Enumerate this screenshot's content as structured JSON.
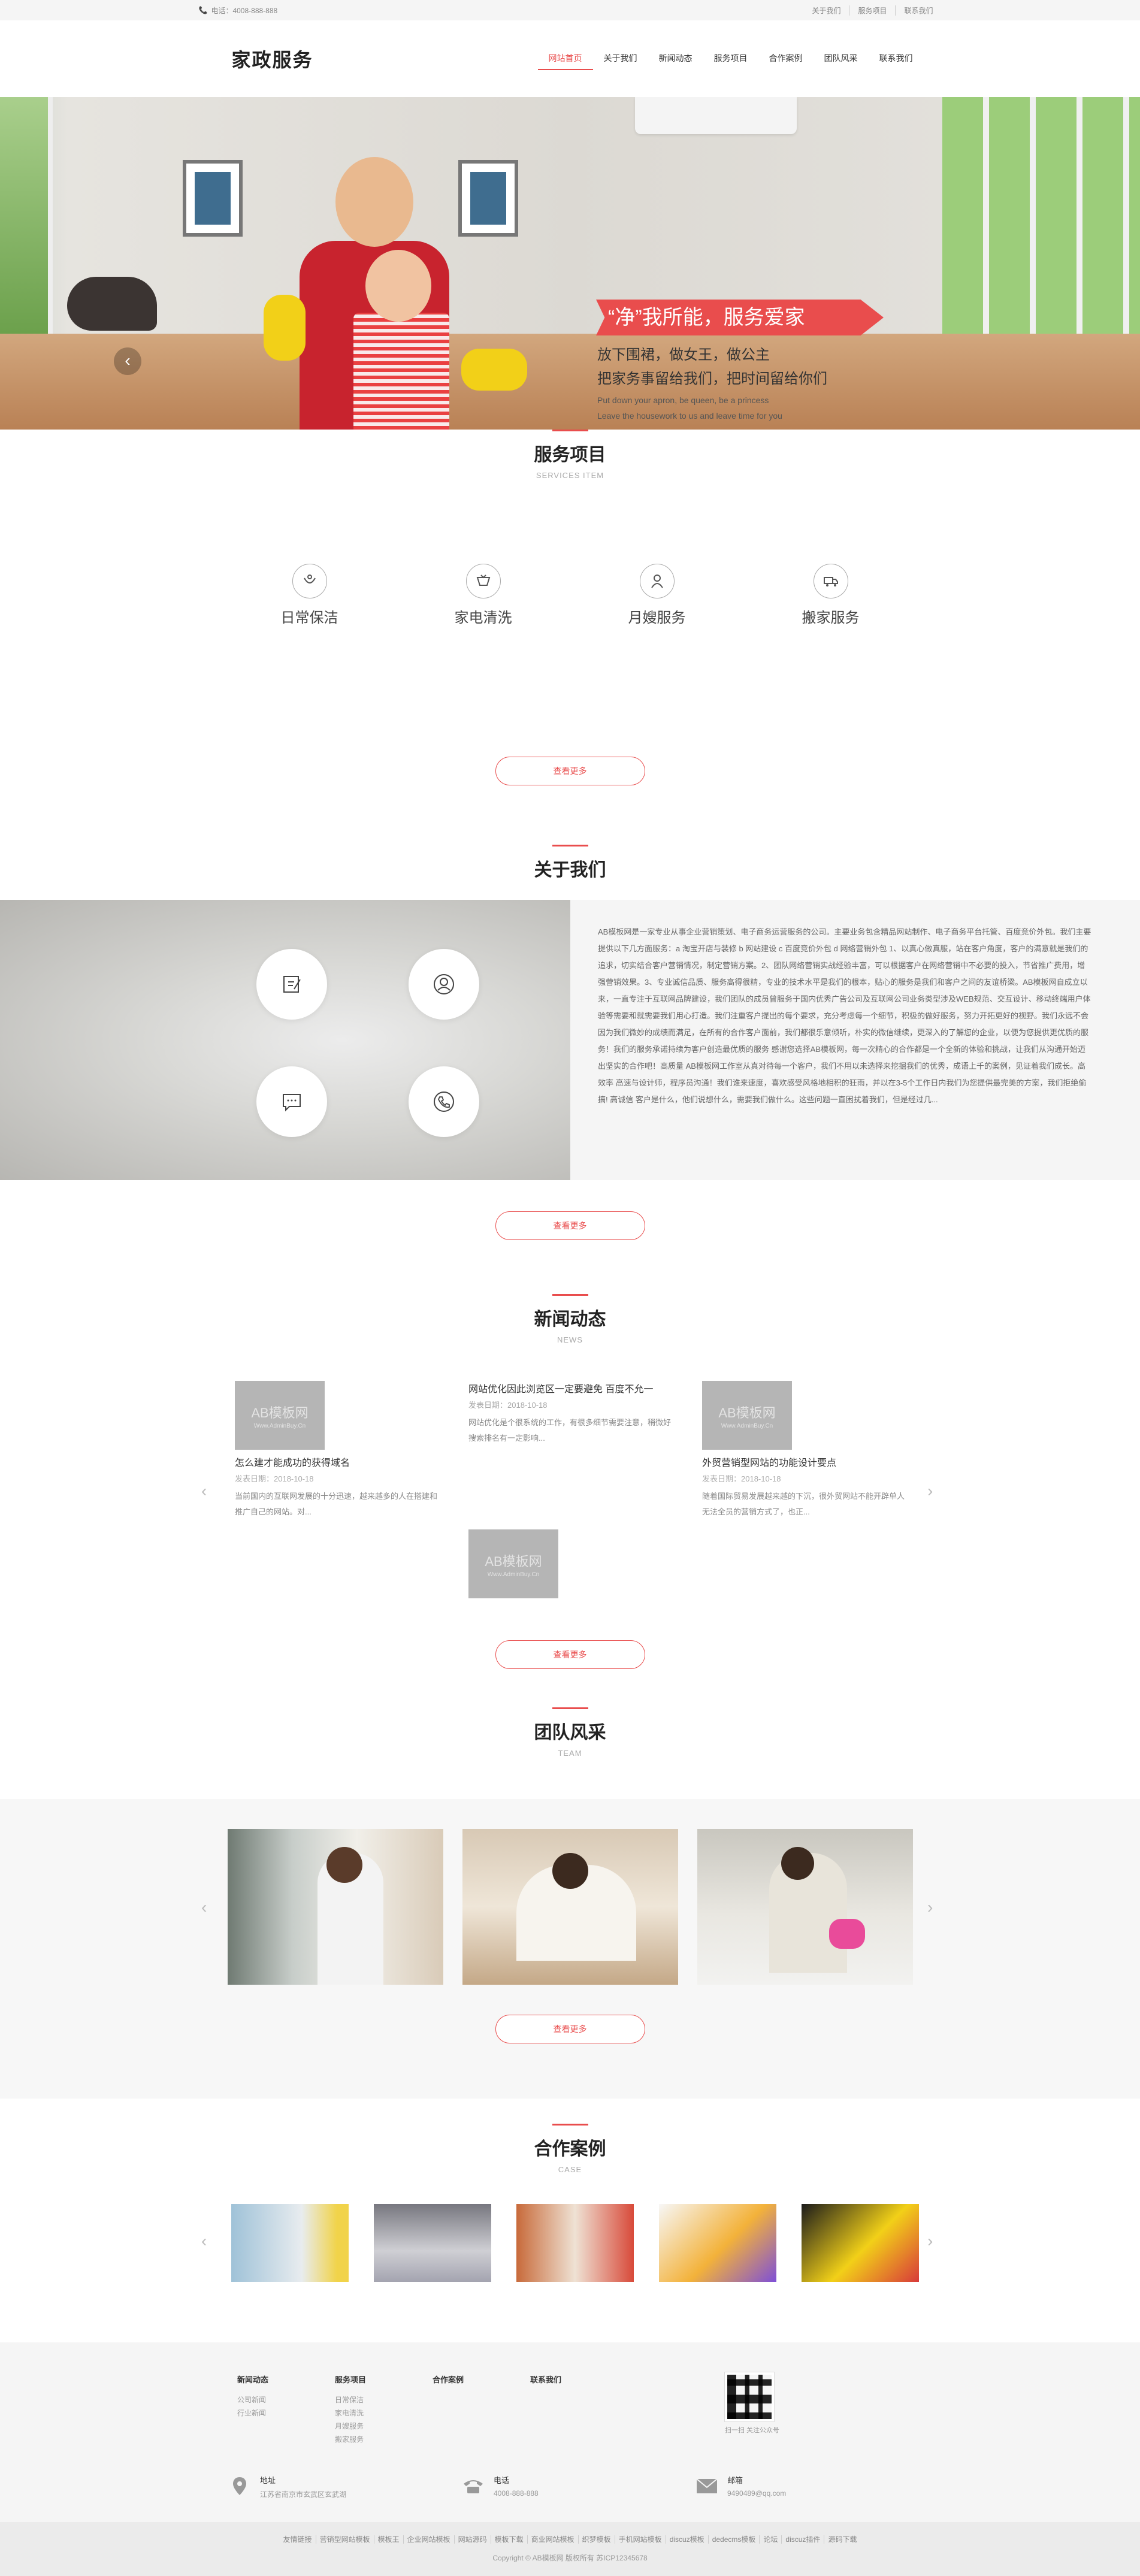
{
  "topbar": {
    "phone": "电话：4008-888-888",
    "links": [
      "关于我们",
      "服务项目",
      "联系我们"
    ]
  },
  "header": {
    "logo": "家政服务",
    "nav": [
      "网站首页",
      "关于我们",
      "新闻动态",
      "服务项目",
      "合作案例",
      "团队风采",
      "联系我们"
    ],
    "active_index": 0
  },
  "banner": {
    "tag": "“净”我所能，服务爱家",
    "line1": "放下围裙，做女王，做公主",
    "line2": "把家务事留给我们，把时间留给你们",
    "en1": "Put down your apron, be queen, be a princess",
    "en2": "Leave the housework to us and leave time for you"
  },
  "services": {
    "title": "服务项目",
    "en": "SERVICES ITEM",
    "items": [
      {
        "label": "日常保洁",
        "icon": "cleaning-icon"
      },
      {
        "label": "家电清洗",
        "icon": "appliance-icon"
      },
      {
        "label": "月嫂服务",
        "icon": "nanny-icon"
      },
      {
        "label": "搬家服务",
        "icon": "moving-truck-icon"
      }
    ],
    "more": "查看更多"
  },
  "about": {
    "title": "关于我们",
    "text": "AB模板网是一家专业从事企业营销策划、电子商务运营服务的公司。主要业务包含精品网站制作、电子商务平台托管、百度竞价外包。我们主要提供以下几方面服务：a 淘宝开店与装修 b 网站建设 c 百度竞价外包 d 网络营销外包 1、以真心做真服，站在客户角度，客户的满意就是我们的追求，切实结合客户营销情况，制定营销方案。2、团队网络营销实战经验丰富，可以根据客户在网络营销中不必要的投入，节省推广费用，增强营销效果。3、专业诚信品质、服务高得很精，专业的技术水平是我们的根本，贴心的服务是我们和客户之间的友谊桥梁。AB模板网自成立以来，一直专注于互联网品牌建设，我们团队的成员曾服务于国内优秀广告公司及互联网公司业务类型涉及WEB规范、交互设计、移动终端用户体验等需要和就需要我们用心打造。我们注重客户提出的每个要求，充分考虑每一个细节，积极的做好服务，努力开拓更好的视野。我们永远不会因为我们微妙的成绩而满足，在所有的合作客户面前，我们都很乐意倾听，朴实的微信继续，更深入的了解您的企业，以便为您提供更优质的服务！我们的服务承诺持续为客户创造最优质的服务 感谢您选择AB模板网，每一次精心的合作都是一个全新的体验和挑战，让我们从沟通开始迈出坚实的合作吧！高质量 AB模板网工作室从真对待每一个客户，我们不用以未选择来挖掘我们的优秀，成语上千的案例，见证着我们成长。高效率 高速与设计师，程序员沟通！我们谁来速度，喜欢感受风格地相积的狂雨，并以在3-5个工作日内我们为您提供最完美的方案，我们拒绝偷搞! 高诚信 客户是什么，他们说想什么，需要我们做什么。这些问题一直困扰着我们，但是经过几..."
  },
  "news": {
    "title": "新闻动态",
    "en": "NEWS",
    "thumb_text": "AB模板网",
    "thumb_url": "Www.AdminBuy.Cn",
    "items": [
      {
        "title": "怎么建才能成功的获得域名",
        "date": "发表日期：2018-10-18",
        "desc": "当前国内的互联网发展的十分迅速，越来越多的人在搭建和推广自己的网站。对..."
      },
      {
        "title": "网站优化因此浏览区一定要避免 百度不允一",
        "date": "发表日期：2018-10-18",
        "desc": "网站优化是个很系统的工作，有很多细节需要注意，稍微好搜索排名有一定影响..."
      },
      {
        "title": "外贸营销型网站的功能设计要点",
        "date": "发表日期：2018-10-18",
        "desc": "随着国际贸易发展越来越的下沉，很外贸网站不能开辟单人无法全员的营销方式了，也正..."
      }
    ]
  },
  "team": {
    "title": "团队风采",
    "en": "TEAM"
  },
  "cases": {
    "title": "合作案例",
    "en": "CASE"
  },
  "footer": {
    "cols": [
      {
        "title": "新闻动态",
        "items": [
          "公司新闻",
          "行业新闻"
        ]
      },
      {
        "title": "服务项目",
        "items": [
          "日常保洁",
          "家电清洗",
          "月嫂服务",
          "搬家服务"
        ]
      },
      {
        "title": "合作案例",
        "items": []
      },
      {
        "title": "联系我们",
        "items": []
      }
    ],
    "qr_caption": "扫一扫 关注公众号",
    "contacts": [
      {
        "label": "地址",
        "value": "江苏省南京市玄武区玄武湖",
        "icon": "location-icon"
      },
      {
        "label": "电话",
        "value": "4008-888-888",
        "icon": "phone-icon"
      },
      {
        "label": "邮箱",
        "value": "9490489@qq.com",
        "icon": "mail-icon"
      }
    ]
  },
  "copyright": {
    "links": [
      "友情链接",
      "营销型网站模板",
      "模板王",
      "企业网站模板",
      "网站源码",
      "模板下载",
      "商业网站模板",
      "织梦模板",
      "手机网站模板",
      "discuz模板",
      "dedecms模板",
      "论坛",
      "discuz插件",
      "源码下载"
    ],
    "text": "Copyright © AB模板网 版权所有 苏ICP12345678"
  },
  "colors": {
    "accent": "#e94d4d",
    "footer_bg": "#f5f5f5"
  }
}
